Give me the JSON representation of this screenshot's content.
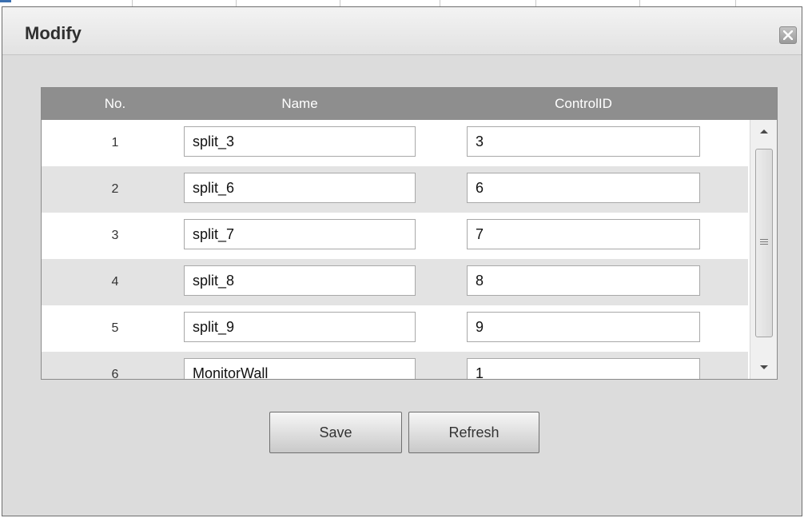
{
  "dialog": {
    "title": "Modify",
    "close_icon": "close-icon"
  },
  "table": {
    "headers": [
      "No.",
      "Name",
      "ControlID"
    ],
    "rows": [
      {
        "no": "1",
        "name": "split_3",
        "control_id": "3"
      },
      {
        "no": "2",
        "name": "split_6",
        "control_id": "6"
      },
      {
        "no": "3",
        "name": "split_7",
        "control_id": "7"
      },
      {
        "no": "4",
        "name": "split_8",
        "control_id": "8"
      },
      {
        "no": "5",
        "name": "split_9",
        "control_id": "9"
      },
      {
        "no": "6",
        "name": "MonitorWall",
        "control_id": "1"
      }
    ]
  },
  "buttons": {
    "save_label": "Save",
    "refresh_label": "Refresh"
  },
  "colors": {
    "header_bg": "#8e8e8e",
    "row_alt_bg": "#e3e3e3",
    "dialog_bg": "#dcdcdc"
  }
}
